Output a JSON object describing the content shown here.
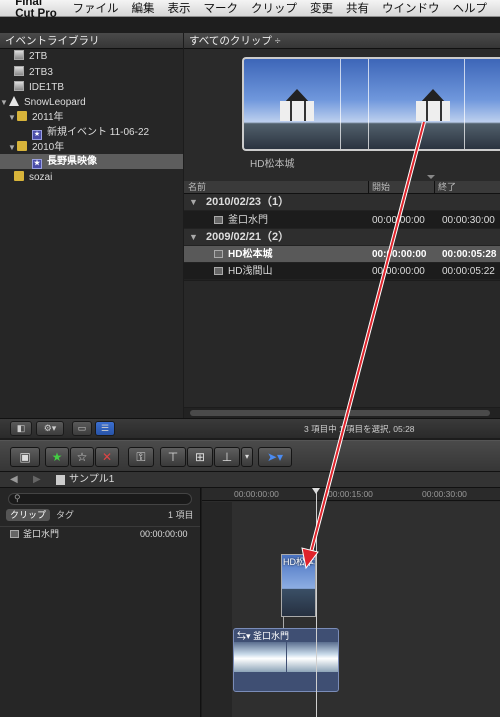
{
  "menubar": {
    "app": "Final Cut Pro",
    "items": [
      "ファイル",
      "編集",
      "表示",
      "マーク",
      "クリップ",
      "変更",
      "共有",
      "ウインドウ",
      "ヘルプ"
    ]
  },
  "library": {
    "header": "イベントライブラリ",
    "items": [
      {
        "label": "2TB",
        "icon": "disk-icon"
      },
      {
        "label": "2TB3",
        "icon": "disk-icon"
      },
      {
        "label": "IDE1TB",
        "icon": "disk-icon"
      },
      {
        "label": "SnowLeopard",
        "icon": "home-icon"
      },
      {
        "label": "2011年",
        "icon": "folder-icon"
      },
      {
        "label": "新規イベント 11-06-22",
        "icon": "event-icon"
      },
      {
        "label": "2010年",
        "icon": "folder-icon"
      },
      {
        "label": "長野県映像",
        "icon": "event-icon"
      },
      {
        "label": "sozai",
        "icon": "folder-icon"
      }
    ]
  },
  "browser": {
    "header": "すべてのクリップ ÷",
    "filmstrip_label": "HD松本城",
    "columns": {
      "name": "名前",
      "start": "開始",
      "end": "終了"
    },
    "groups": [
      {
        "title": "2010/02/23（1）",
        "clips": [
          {
            "name": "釜口水門",
            "start": "00:00:00:00",
            "end": "00:00:30:00"
          }
        ]
      },
      {
        "title": "2009/02/21（2）",
        "clips": [
          {
            "name": "HD松本城",
            "start": "00:00:00:00",
            "end": "00:00:05:28"
          },
          {
            "name": "HD浅間山",
            "start": "00:00:00:00",
            "end": "00:00:05:22"
          }
        ]
      }
    ]
  },
  "status": {
    "text": "3 項目中 1 項目を選択, 05:28"
  },
  "timeline": {
    "project": "サンプル1",
    "index_tabs": [
      "クリップ",
      "タグ"
    ],
    "index_count": "1 項目",
    "index_row": {
      "name": "釜口水門",
      "time": "00:00:00:00"
    },
    "ruler": [
      "00:00:00:00",
      "00:00:15:00",
      "00:00:30:00"
    ],
    "connected_clip": "HD松本城",
    "storyline_clip": "釜口水門"
  },
  "colors": {
    "arrow": "#e0232b",
    "selection": "#5d5d5d",
    "accent": "#2f6fd8"
  }
}
